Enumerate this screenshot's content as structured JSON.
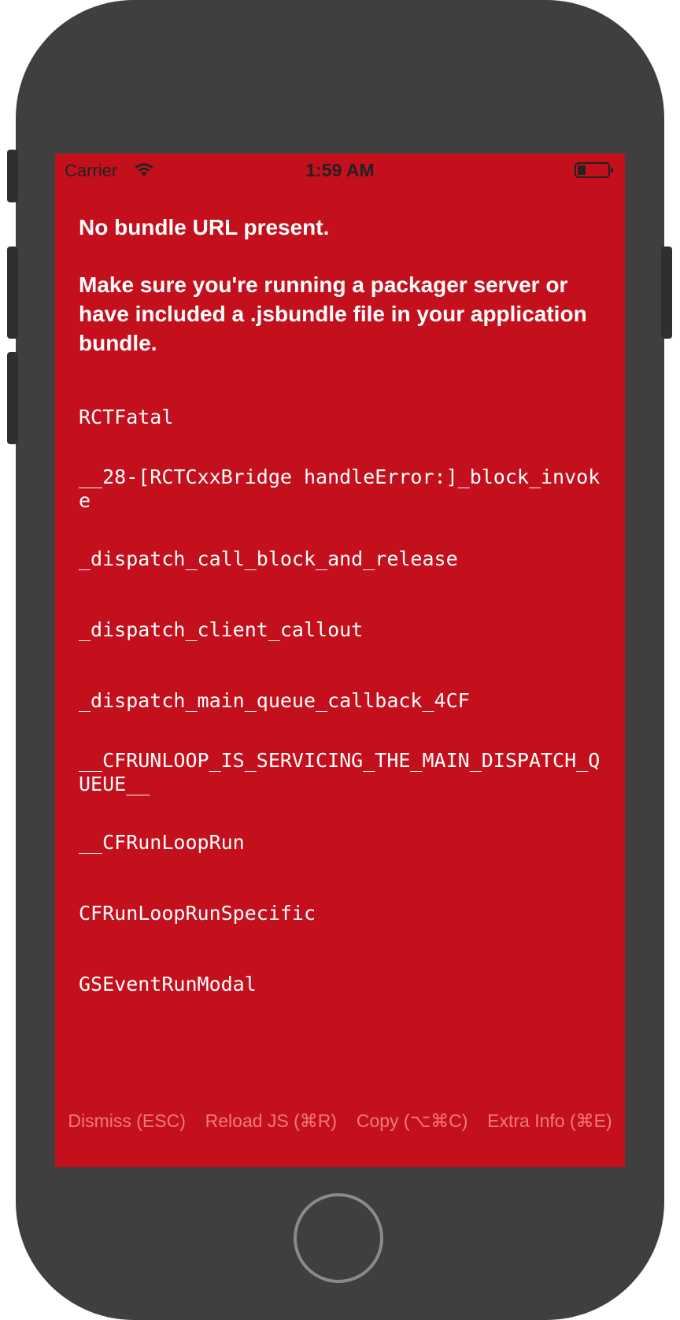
{
  "status_bar": {
    "carrier": "Carrier",
    "time": "1:59 AM",
    "wifi_icon": "wifi-icon",
    "battery_icon": "battery-icon"
  },
  "error": {
    "title": "No bundle URL present.",
    "description": "Make sure you're running a packager server or have included a .jsbundle file in your application bundle."
  },
  "stack_frames": [
    "RCTFatal",
    "__28-[RCTCxxBridge handleError:]_block_invoke",
    "_dispatch_call_block_and_release",
    "_dispatch_client_callout",
    "_dispatch_main_queue_callback_4CF",
    "__CFRUNLOOP_IS_SERVICING_THE_MAIN_DISPATCH_QUEUE__",
    "__CFRunLoopRun",
    "CFRunLoopRunSpecific",
    "GSEventRunModal"
  ],
  "actions": {
    "dismiss": "Dismiss (ESC)",
    "reload": "Reload JS (⌘R)",
    "copy": "Copy (⌥⌘C)",
    "extra_info": "Extra Info (⌘E)"
  },
  "colors": {
    "screen_background": "#c4101d",
    "device_body": "#3f3f3f",
    "action_text": "#f07a7a"
  }
}
